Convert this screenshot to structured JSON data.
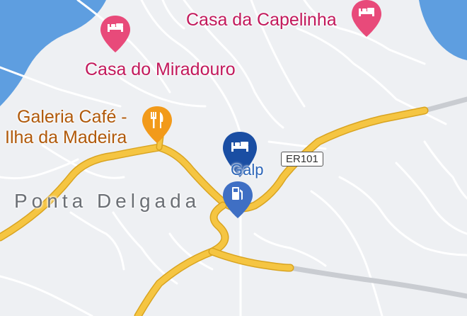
{
  "colors": {
    "land": "#eef0f3",
    "water": "#5e9ee0",
    "road_minor": "#ffffff",
    "road_minor_edge": "#c9cdd3",
    "road_major": "#f5c542",
    "road_major_edge": "#d9a420",
    "road_gray": "#c9ccd1",
    "hotel_pin": "#e84a7a",
    "restaurant_pin": "#f29a1a",
    "selected_pin": "#1a4ea3",
    "gas_pin": "#3f6fc4"
  },
  "labels": {
    "casa_capelinha": "Casa da Capelinha",
    "casa_miradouro": "Casa do Miradouro",
    "galeria_line1": "Galeria Café -",
    "galeria_line2": "Ilha da Madeira",
    "town": "Ponta Delgada",
    "galp": "Galp",
    "road_shield": "ER101"
  },
  "icons": {
    "hotel_icon": "bed-icon",
    "restaurant_icon": "fork-knife-icon",
    "gas_icon": "fuel-pump-icon"
  }
}
